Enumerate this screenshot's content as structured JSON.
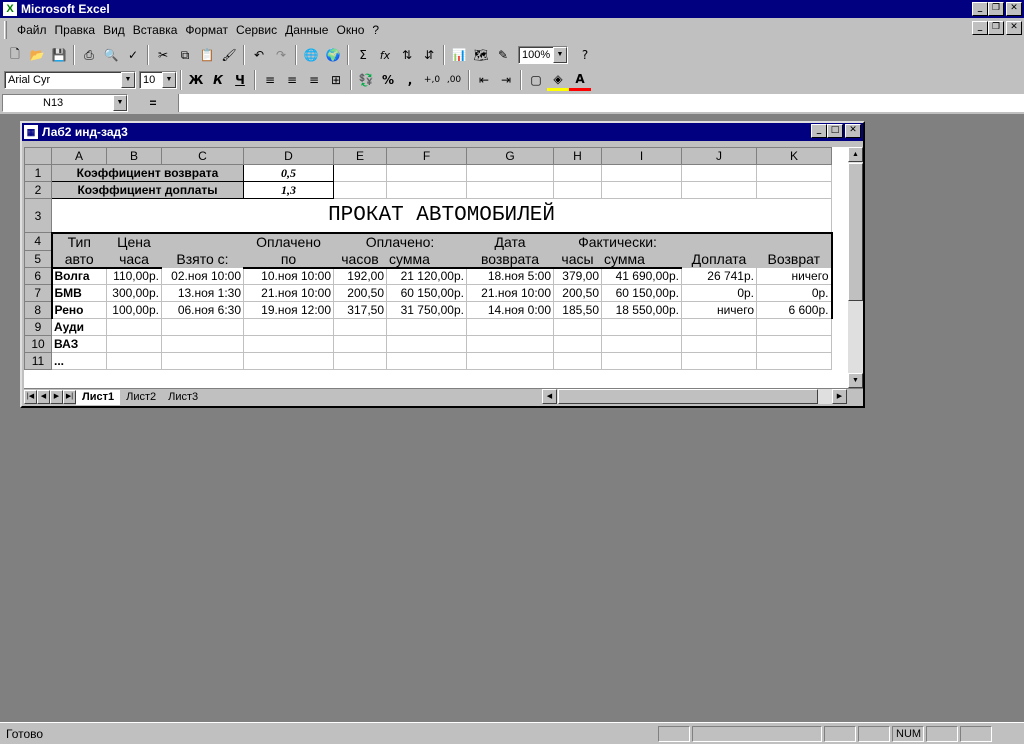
{
  "app": {
    "title": "Microsoft Excel"
  },
  "menu": [
    "Файл",
    "Правка",
    "Вид",
    "Вставка",
    "Формат",
    "Сервис",
    "Данные",
    "Окно",
    "?"
  ],
  "toolbar": {
    "zoom": "100%",
    "font": "Arial Cyr",
    "font_size": "10",
    "bold": "Ж",
    "italic": "К",
    "underline": "Ч",
    "sum": "Σ",
    "fx": "fx",
    "percent": "%",
    "comma": ","
  },
  "formula": {
    "cell": "N13",
    "eq": "=",
    "value": ""
  },
  "workbook": {
    "title": "Лаб2 инд-зад3"
  },
  "sheet": {
    "columns": [
      "A",
      "B",
      "C",
      "D",
      "E",
      "F",
      "G",
      "H",
      "I",
      "J",
      "K"
    ],
    "rows": [
      "1",
      "2",
      "3",
      "4",
      "5",
      "6",
      "7",
      "8",
      "9",
      "10",
      "11"
    ],
    "coef_return_label": "Коэффициент возврата",
    "coef_return_value": "0,5",
    "coef_surcharge_label": "Коэффициент доплаты",
    "coef_surcharge_value": "1,3",
    "main_title": "ПРОКАТ  АВТОМОБИЛЕЙ",
    "h_type1": "Тип",
    "h_type2": "авто",
    "h_price1": "Цена",
    "h_price2": "часа",
    "h_taken": "Взято с:",
    "h_paid_until1": "Оплачено",
    "h_paid_until2": "по",
    "h_paid": "Оплачено:",
    "h_paid_hours": "часов",
    "h_paid_sum": "сумма",
    "h_return1": "Дата",
    "h_return2": "возврата",
    "h_actual": "Фактически:",
    "h_actual_hours": "часы",
    "h_actual_sum": "сумма",
    "h_surcharge": "Доплата",
    "h_refund": "Возврат",
    "data": [
      [
        "Волга",
        "110,00р.",
        "02.ноя 10:00",
        "10.ноя 10:00",
        "192,00",
        "21 120,00р.",
        "18.ноя 5:00",
        "379,00",
        "41 690,00р.",
        "26 741р.",
        "ничего"
      ],
      [
        "БМВ",
        "300,00р.",
        "13.ноя 1:30",
        "21.ноя 10:00",
        "200,50",
        "60 150,00р.",
        "21.ноя 10:00",
        "200,50",
        "60 150,00р.",
        "0р.",
        "0р."
      ],
      [
        "Рено",
        "100,00р.",
        "06.ноя 6:30",
        "19.ноя 12:00",
        "317,50",
        "31 750,00р.",
        "14.ноя 0:00",
        "185,50",
        "18 550,00р.",
        "ничего",
        "6 600р."
      ]
    ],
    "extra": [
      "Ауди",
      "ВАЗ",
      "..."
    ]
  },
  "tabs": [
    "Лист1",
    "Лист2",
    "Лист3"
  ],
  "status": {
    "ready": "Готово",
    "num": "NUM"
  }
}
